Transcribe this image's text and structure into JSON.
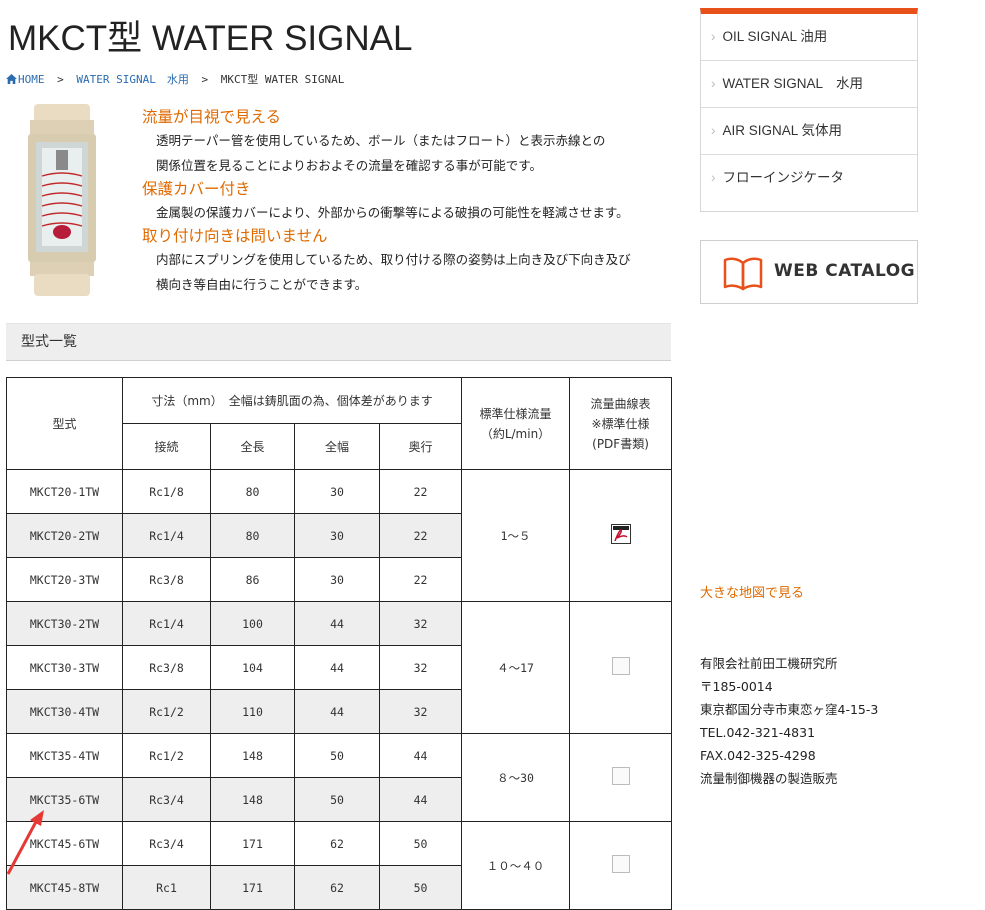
{
  "page": {
    "title": "MKCT型 WATER SIGNAL"
  },
  "breadcrumb": {
    "home": "HOME",
    "sep": ">",
    "category": "WATER SIGNAL　水用",
    "current": "MKCT型 WATER SIGNAL"
  },
  "features": [
    {
      "heading": "流量が目視で見える",
      "lines": [
        "透明テーパー管を使用しているため、ボール（またはフロート）と表示赤線との",
        "関係位置を見ることによりおおよその流量を確認する事が可能です。"
      ]
    },
    {
      "heading": "保護カバー付き",
      "lines": [
        "金属製の保護カバーにより、外部からの衝撃等による破損の可能性を軽減させます。"
      ]
    },
    {
      "heading": "取り付け向きは問いません",
      "lines": [
        "内部にスプリングを使用しているため、取り付ける際の姿勢は上向き及び下向き及び",
        "横向き等自由に行うことができます。"
      ]
    }
  ],
  "section": {
    "title": "型式一覧"
  },
  "table": {
    "header": {
      "model": "型式",
      "dimensions": "寸法（mm）　全幅は鋳肌面の為、個体差があります",
      "flow_line1": "標準仕様流量",
      "flow_line2": "（約L/min）",
      "curve_line1": "流量曲線表",
      "curve_line2": "※標準仕様",
      "curve_line3": "(PDF書類)",
      "connection": "接続",
      "length": "全長",
      "width": "全幅",
      "depth": "奥行"
    },
    "rows": [
      {
        "model": "MKCT20-1TW",
        "connection": "Rc1/8",
        "length": "80",
        "width": "30",
        "depth": "22"
      },
      {
        "model": "MKCT20-2TW",
        "connection": "Rc1/4",
        "length": "80",
        "width": "30",
        "depth": "22"
      },
      {
        "model": "MKCT20-3TW",
        "connection": "Rc3/8",
        "length": "86",
        "width": "30",
        "depth": "22"
      },
      {
        "model": "MKCT30-2TW",
        "connection": "Rc1/4",
        "length": "100",
        "width": "44",
        "depth": "32"
      },
      {
        "model": "MKCT30-3TW",
        "connection": "Rc3/8",
        "length": "104",
        "width": "44",
        "depth": "32"
      },
      {
        "model": "MKCT30-4TW",
        "connection": "Rc1/2",
        "length": "110",
        "width": "44",
        "depth": "32"
      },
      {
        "model": "MKCT35-4TW",
        "connection": "Rc1/2",
        "length": "148",
        "width": "50",
        "depth": "44"
      },
      {
        "model": "MKCT35-6TW",
        "connection": "Rc3/4",
        "length": "148",
        "width": "50",
        "depth": "44"
      },
      {
        "model": "MKCT45-6TW",
        "connection": "Rc3/4",
        "length": "171",
        "width": "62",
        "depth": "50"
      },
      {
        "model": "MKCT45-8TW",
        "connection": "Rc1",
        "length": "171",
        "width": "62",
        "depth": "50"
      }
    ],
    "flow_groups": [
      "1～５",
      "４～17",
      "８～30",
      "１０～４０"
    ]
  },
  "sidebar": {
    "menu": [
      {
        "label": "OIL SIGNAL 油用"
      },
      {
        "label": "WATER SIGNAL　水用"
      },
      {
        "label": "AIR SIGNAL 気体用"
      },
      {
        "label": "フローインジケータ"
      }
    ],
    "catalog_label": "WEB CATALOG",
    "map_link": "大きな地図で見る",
    "company": {
      "name": "有限会社前田工機研究所",
      "zip": "〒185-0014",
      "address": "東京都国分寺市東恋ヶ窪4-15-3",
      "tel": "TEL.042-321-4831",
      "fax": "FAX.042-325-4298",
      "business": "流量制御機器の製造販売"
    }
  },
  "colors": {
    "accent_orange": "#e06a00",
    "menu_top_bar": "#e8521a",
    "link_blue": "#2b6cb0"
  }
}
